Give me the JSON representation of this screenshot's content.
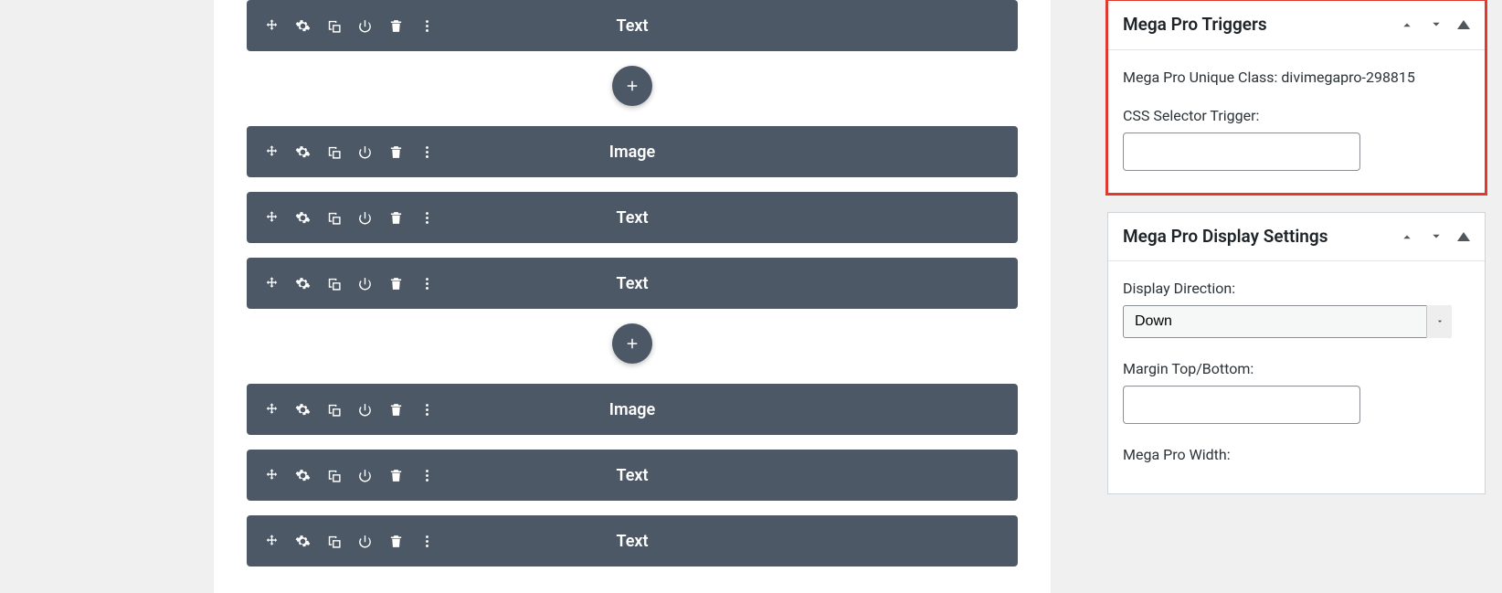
{
  "modules": {
    "group1": [
      {
        "label": "Text"
      }
    ],
    "group2": [
      {
        "label": "Image"
      },
      {
        "label": "Text"
      },
      {
        "label": "Text"
      }
    ],
    "group3": [
      {
        "label": "Image"
      },
      {
        "label": "Text"
      },
      {
        "label": "Text"
      }
    ]
  },
  "sidebar": {
    "panel1": {
      "title": "Mega Pro Triggers",
      "unique_class_label": "Mega Pro Unique Class: divimegapro-298815",
      "css_trigger_label": "CSS Selector Trigger:",
      "css_trigger_value": ""
    },
    "panel2": {
      "title": "Mega Pro Display Settings",
      "direction_label": "Display Direction:",
      "direction_value": "Down",
      "margin_label": "Margin Top/Bottom:",
      "margin_value": "",
      "width_label": "Mega Pro Width:"
    }
  }
}
